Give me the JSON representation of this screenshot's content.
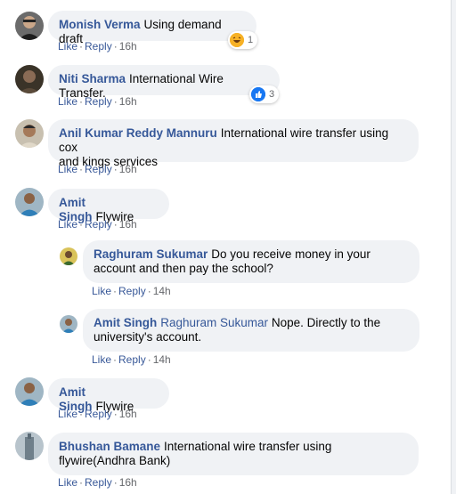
{
  "actions": {
    "like": "Like",
    "reply": "Reply"
  },
  "comments": [
    {
      "author": "Monish Verma",
      "text": "Using demand draft",
      "time": "16h",
      "reaction_count": "1",
      "reaction_icon": "haha-emoji-icon"
    },
    {
      "author": "Niti Sharma",
      "text": "International Wire Transfer.",
      "time": "16h",
      "reaction_count": "3",
      "reaction_icon": "like-thumb-icon"
    },
    {
      "author": "Anil Kumar Reddy Mannuru",
      "text": "International wire transfer using cox",
      "text2": "and kings services",
      "time": "16h"
    },
    {
      "author": "Amit Singh",
      "text": "Flywire",
      "time": "16h"
    },
    {
      "author": "Raghuram Sukumar",
      "text": "Do you receive money in your",
      "text2": "account and then pay the school?",
      "time": "14h"
    },
    {
      "author": "Amit Singh",
      "mention": "Raghuram Sukumar",
      "text": "Nope. Directly to the",
      "text2": "university's account.",
      "time": "14h"
    },
    {
      "author": "Amit Singh",
      "text": "Flywire",
      "time": "16h"
    },
    {
      "author": "Bhushan Bamane",
      "text": "International wire transfer using",
      "text2": "flywire(Andhra Bank)",
      "time": "16h"
    }
  ],
  "colors": {
    "link": "#365899",
    "bubble": "#f0f2f5",
    "meta": "#65676b",
    "like_blue": "#1877f2",
    "haha_yellow": "#f7b125"
  }
}
